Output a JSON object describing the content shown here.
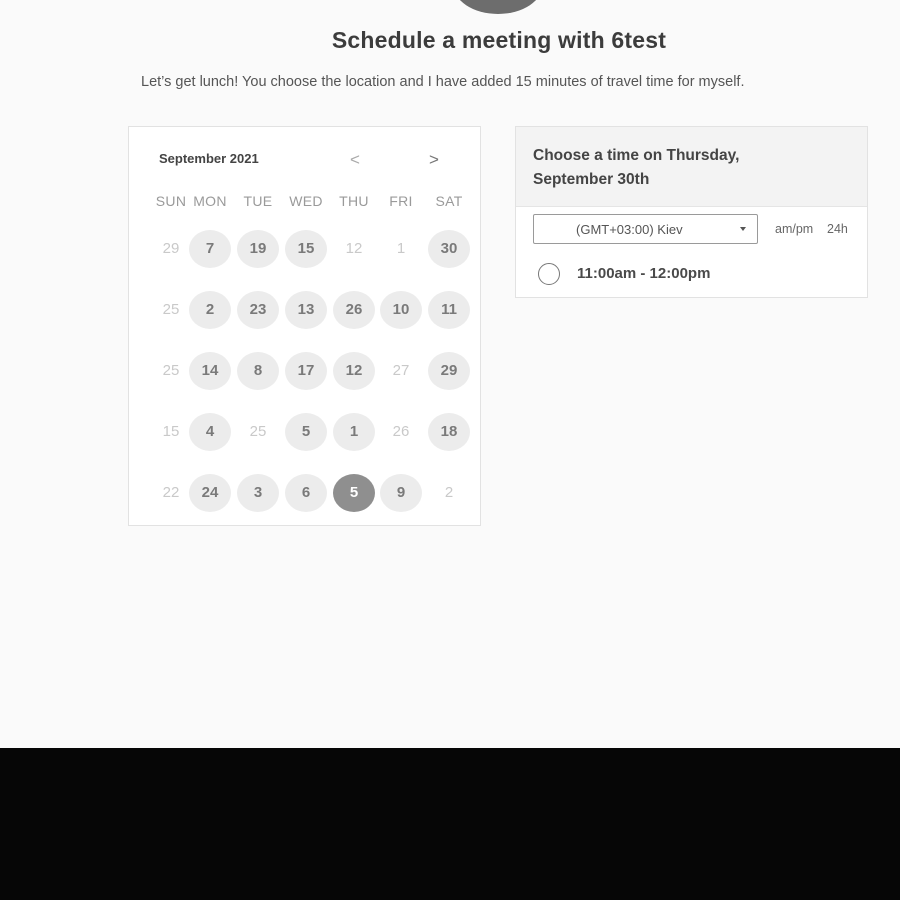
{
  "header": {
    "title": "Schedule a meeting with 6test",
    "description": "Let’s get lunch! You choose the location and I have added 15 minutes of travel time for myself."
  },
  "calendar": {
    "month_label": "September 2021",
    "prev_icon": "chevron-left-icon",
    "next_icon": "chevron-right-icon",
    "prev_glyph": "<",
    "next_glyph": ">",
    "weekdays": [
      "SUN",
      "MON",
      "TUE",
      "WED",
      "THU",
      "FRI",
      "SAT"
    ],
    "weeks": [
      [
        {
          "d": "29",
          "s": "dis"
        },
        {
          "d": "7",
          "s": "av"
        },
        {
          "d": "19",
          "s": "av"
        },
        {
          "d": "15",
          "s": "av"
        },
        {
          "d": "12",
          "s": "dis"
        },
        {
          "d": "1",
          "s": "dis"
        },
        {
          "d": "30",
          "s": "av"
        }
      ],
      [
        {
          "d": "25",
          "s": "dis"
        },
        {
          "d": "2",
          "s": "av"
        },
        {
          "d": "23",
          "s": "av"
        },
        {
          "d": "13",
          "s": "av"
        },
        {
          "d": "26",
          "s": "av"
        },
        {
          "d": "10",
          "s": "av"
        },
        {
          "d": "11",
          "s": "av"
        }
      ],
      [
        {
          "d": "25",
          "s": "dis"
        },
        {
          "d": "14",
          "s": "av"
        },
        {
          "d": "8",
          "s": "av"
        },
        {
          "d": "17",
          "s": "av"
        },
        {
          "d": "12",
          "s": "av"
        },
        {
          "d": "27",
          "s": "dis"
        },
        {
          "d": "29",
          "s": "av"
        }
      ],
      [
        {
          "d": "15",
          "s": "dis"
        },
        {
          "d": "4",
          "s": "av"
        },
        {
          "d": "25",
          "s": "dis"
        },
        {
          "d": "5",
          "s": "av"
        },
        {
          "d": "1",
          "s": "av"
        },
        {
          "d": "26",
          "s": "dis"
        },
        {
          "d": "18",
          "s": "av"
        }
      ],
      [
        {
          "d": "22",
          "s": "dis"
        },
        {
          "d": "24",
          "s": "av"
        },
        {
          "d": "3",
          "s": "av"
        },
        {
          "d": "6",
          "s": "av"
        },
        {
          "d": "5",
          "s": "sel"
        },
        {
          "d": "9",
          "s": "av"
        },
        {
          "d": "2",
          "s": "dis"
        }
      ]
    ]
  },
  "time_picker": {
    "heading": "Choose a time on Thursday, September 30th",
    "timezone": "(GMT+03:00) Kiev",
    "format_ampm": "am/pm",
    "format_24h": "24h",
    "slots": [
      "11:00am - 12:00pm"
    ]
  },
  "colors": {
    "background": "#fafafa",
    "selected_day": "#8f8f8f",
    "available_day": "#ececec"
  }
}
